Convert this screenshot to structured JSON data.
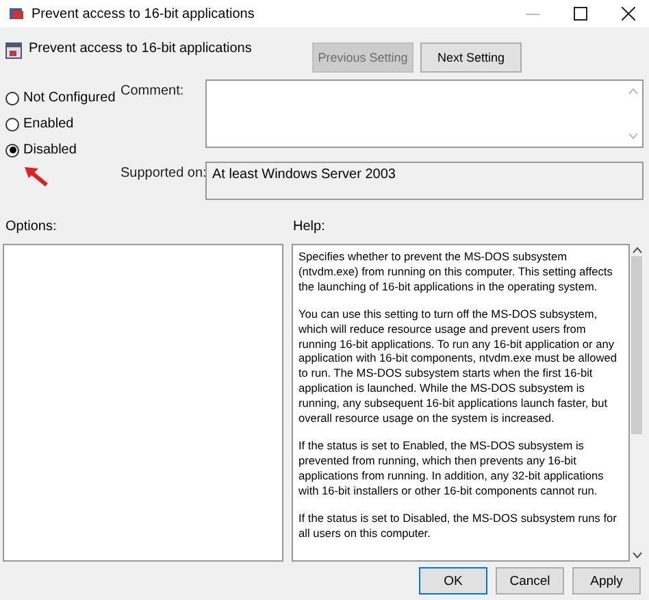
{
  "window": {
    "title": "Prevent access to 16-bit applications"
  },
  "header": {
    "title": "Prevent access to 16-bit applications",
    "buttons": [
      {
        "label": "Previous Setting",
        "disabled": true
      },
      {
        "label": "Next Setting",
        "disabled": false
      }
    ]
  },
  "states": [
    {
      "label": "Not Configured",
      "selected": false
    },
    {
      "label": "Enabled",
      "selected": false
    },
    {
      "label": "Disabled",
      "selected": true
    }
  ],
  "comment": {
    "label": "Comment:"
  },
  "supported_on": {
    "label": "Supported on:",
    "value": "At least Windows Server 2003"
  },
  "options": {
    "label": "Options:"
  },
  "help": {
    "label": "Help:",
    "paragraphs": [
      "Specifies whether to prevent the MS-DOS subsystem (ntvdm.exe) from running on this computer. This setting affects the launching of 16-bit applications in the operating system.",
      "You can use this setting to turn off the MS-DOS subsystem, which will reduce resource usage and prevent users from running 16-bit applications. To run any 16-bit application or any application with 16-bit components, ntvdm.exe must be allowed to run. The MS-DOS subsystem starts when the first 16-bit application is launched. While the MS-DOS subsystem is running, any subsequent 16-bit applications launch faster, but overall resource usage on the system is increased.",
      "If the status is set to Enabled, the MS-DOS subsystem is prevented from running, which then prevents any 16-bit applications from running. In addition, any 32-bit applications with 16-bit installers or other 16-bit components cannot run.",
      "If the status is set to Disabled, the MS-DOS subsystem runs for all users on this computer."
    ]
  },
  "footer_buttons": [
    {
      "label": "OK",
      "default": true
    },
    {
      "label": "Cancel",
      "default": false
    },
    {
      "label": "Apply",
      "default": false
    }
  ]
}
